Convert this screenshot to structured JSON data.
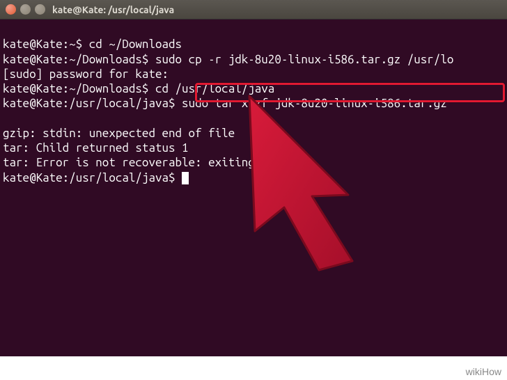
{
  "titlebar": {
    "title": "kate@Kate: /usr/local/java"
  },
  "lines": {
    "l1_prompt": "kate@Kate:~$ ",
    "l1_cmd": "cd ~/Downloads",
    "l2_prompt": "kate@Kate:~/Downloads$ ",
    "l2_cmd": "sudo cp -r jdk-8u20-linux-i586.tar.gz /usr/lo",
    "l3": "[sudo] password for kate:",
    "l4_prompt": "kate@Kate:~/Downloads$ ",
    "l4_cmd": "cd /usr/local/java",
    "l5_prompt": "kate@Kate:/usr/local/java$ ",
    "l5_cmd": "sudo tar xvzf jdk-8u20-linux-i586.tar.gz",
    "blank1": " ",
    "l6": "gzip: stdin: unexpected end of file",
    "l7": "tar: Child returned status 1",
    "l8": "tar: Error is not recoverable: exiting now",
    "l9_prompt": "kate@Kate:/usr/local/java$ "
  },
  "watermark": "wikiHow"
}
